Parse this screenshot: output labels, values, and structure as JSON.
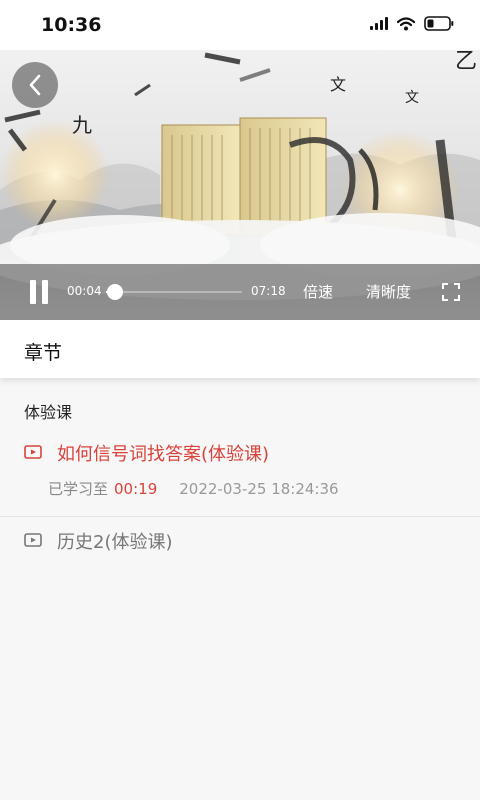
{
  "status_bar": {
    "time": "10:36"
  },
  "player": {
    "current_time": "00:04",
    "total_time": "07:18",
    "progress_fraction": 0.009,
    "speed_label": "倍速",
    "quality_label": "清晰度",
    "overlay_glyphs": [
      "文",
      "九",
      "文",
      "乙"
    ]
  },
  "chapter": {
    "title": "章节"
  },
  "section": {
    "title": "体验课"
  },
  "lessons": [
    {
      "title": "如何信号词找答案(体验课)",
      "progress_label": "已学习至",
      "progress_time": "00:19",
      "date": "2022-03-25 18:24:36",
      "active": true
    },
    {
      "title": "历史2(体验课)",
      "active": false
    }
  ],
  "colors": {
    "accent": "#d9423a",
    "inactive_text": "#777777"
  }
}
